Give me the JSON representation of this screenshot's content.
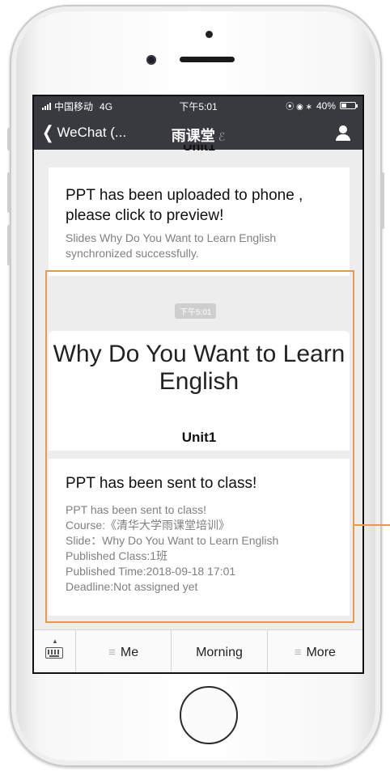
{
  "status_bar": {
    "carrier": "中国移动",
    "network": "4G",
    "time": "下午5:01",
    "icons_right": "⦿ ◉ ∗",
    "battery": "40%",
    "battery_level": 0.4
  },
  "nav": {
    "back_label": "WeChat (...",
    "title": "雨课堂",
    "ear_icon": "ear-icon",
    "profile_icon": "person-icon"
  },
  "chat": {
    "partial_unit": "Unit1",
    "card1": {
      "title": "PPT has been uploaded to phone , please click to preview!",
      "desc": "Slides Why Do You Want to Learn English synchronized successfully."
    },
    "timestamp": "下午5:01",
    "ppt_preview": {
      "title": "Why Do You Want to Learn English",
      "unit": "Unit1"
    },
    "card2": {
      "title": "PPT has been sent to class!",
      "lines": [
        "PPT has been sent to class!",
        "Course:《清华大学雨课堂培训》",
        "Slide：Why Do You Want to Learn English",
        "Published Class:1班",
        "Published Time:2018-09-18 17:01",
        "Deadline:Not assigned yet"
      ]
    }
  },
  "menu": {
    "keyboard_icon": "keyboard-icon",
    "items": [
      "Me",
      "Morning",
      "More"
    ]
  },
  "colors": {
    "header_bg": "#393a3f",
    "highlight": "#e59b4a",
    "chat_bg": "#ededed"
  }
}
